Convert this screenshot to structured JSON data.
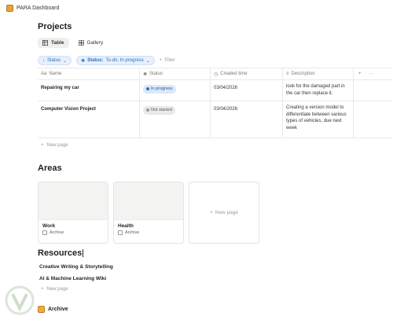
{
  "window": {
    "title": "PARA Dashboard"
  },
  "projects": {
    "heading": "Projects",
    "tabs": [
      {
        "label": "Table",
        "active": true
      },
      {
        "label": "Gallery",
        "active": false
      }
    ],
    "filters": {
      "status_pill": "Status",
      "status_filter_prefix": "Status:",
      "status_filter_value": "To-do, In progress",
      "add_filter": "Filter"
    },
    "columns": [
      "Name",
      "Status",
      "Created time",
      "Description"
    ],
    "rows": [
      {
        "name": "Repairing my car",
        "status": "In progress",
        "created": "03/04/2026",
        "description": "look for the damaged part in the car then replace it."
      },
      {
        "name": "Computer Vision Project",
        "status": "Not started",
        "created": "03/04/2026",
        "description": "Creating a version model to differentiate between various types of vehicles, due next week"
      }
    ],
    "new_page": "New page"
  },
  "areas": {
    "heading": "Areas",
    "cards": [
      {
        "title": "Work",
        "archive_label": "Archive"
      },
      {
        "title": "Health",
        "archive_label": "Archive"
      }
    ],
    "new_page": "New page"
  },
  "resources": {
    "heading": "Resources",
    "items": [
      "Creative Writing & Storytelling",
      "AI & Machine Learning Wiki"
    ],
    "new_page": "New page"
  },
  "archive": {
    "label": "Archive"
  },
  "colors": {
    "accent_blue": "#2c6ec1",
    "in_progress": "#2f74c8",
    "not_started": "#9b9a97",
    "archive_icon": "#f0a84b"
  }
}
